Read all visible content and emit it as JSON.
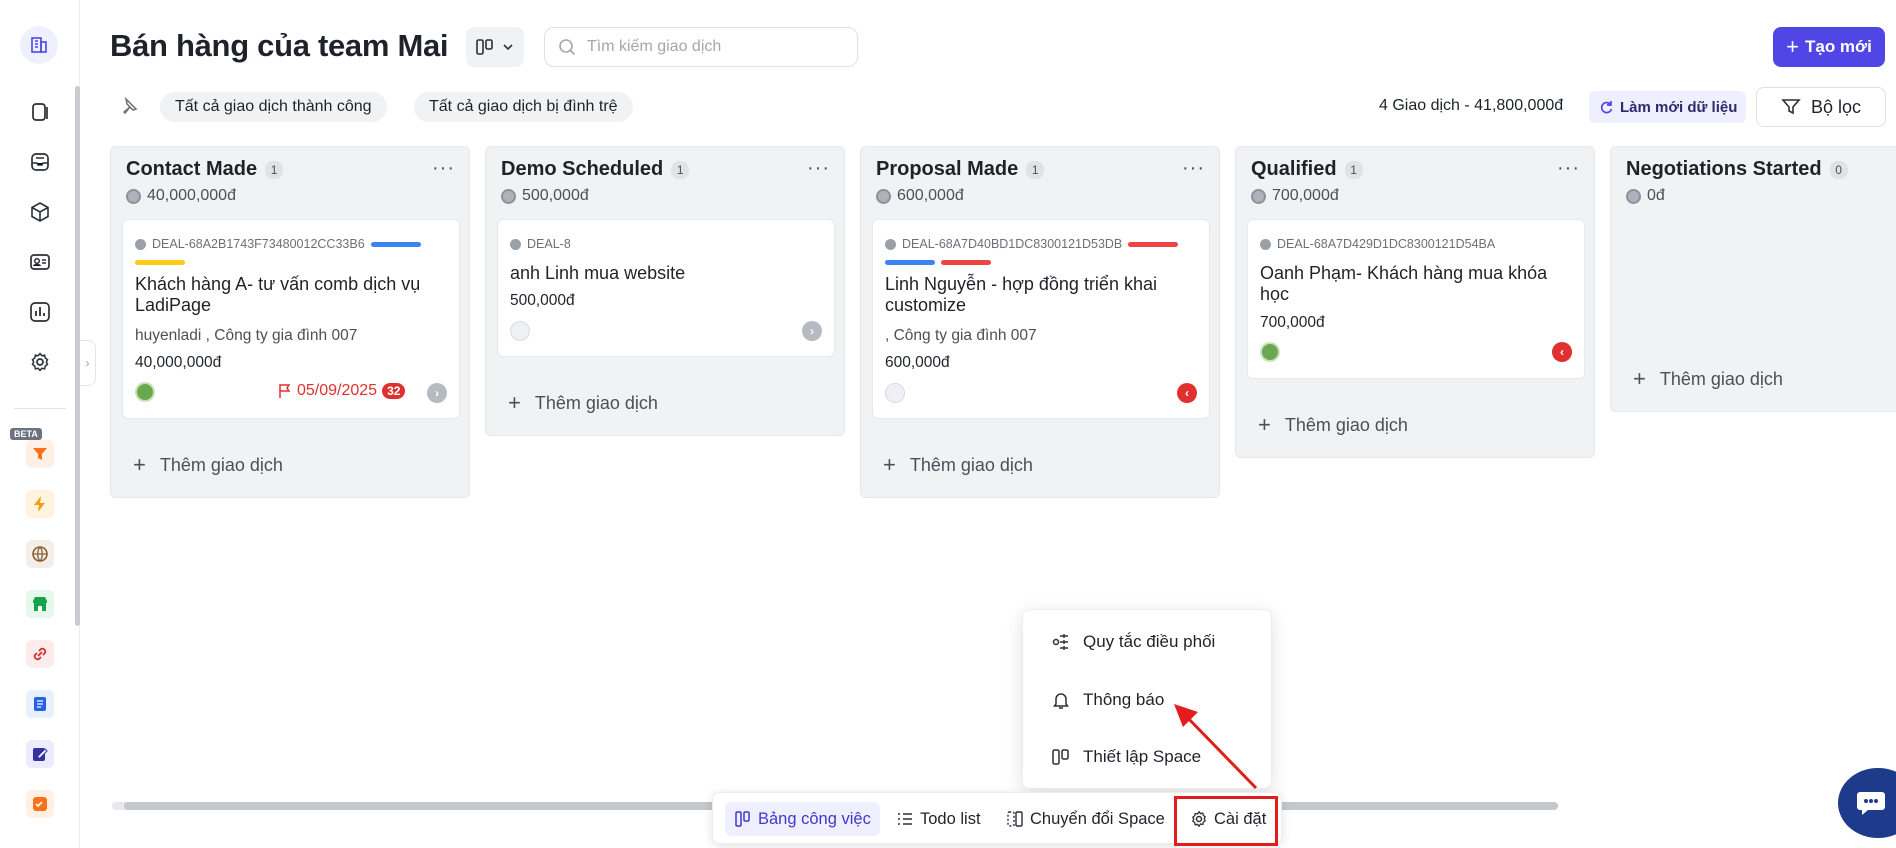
{
  "header": {
    "title": "Bán hàng của team Mai",
    "search_placeholder": "Tìm kiếm giao dịch",
    "new_button": "Tạo mới"
  },
  "sidebar": {
    "beta_badge": "BETA"
  },
  "filters": {
    "chip_success": "Tất cả giao dịch thành công",
    "chip_stuck": "Tất cả giao dịch bị đình trệ",
    "summary": "4 Giao dịch - 41,800,000đ",
    "refresh": "Làm mới dữ liệu",
    "filter_button": "Bộ lọc"
  },
  "columns": [
    {
      "title": "Contact Made",
      "count": "1",
      "total": "40,000,000đ",
      "add_label": "Thêm giao dịch",
      "card": {
        "deal_id": "DEAL-68A2B1743F73480012CC33B6",
        "title": "Khách hàng A- tư vấn comb dịch vụ LadiPage",
        "sub": "huyenladi , Công ty gia đình 007",
        "amount": "40,000,000đ",
        "due": "05/09/2025",
        "badge": "32"
      }
    },
    {
      "title": "Demo Scheduled",
      "count": "1",
      "total": "500,000đ",
      "add_label": "Thêm giao dịch",
      "card": {
        "deal_id": "DEAL-8",
        "title": "anh Linh mua website",
        "amount": "500,000đ"
      }
    },
    {
      "title": "Proposal Made",
      "count": "1",
      "total": "600,000đ",
      "add_label": "Thêm giao dịch",
      "card": {
        "deal_id": "DEAL-68A7D40BD1DC8300121D53DB",
        "title": "Linh Nguyễn - hợp đồng triển khai customize",
        "sub": ", Công ty gia đình 007",
        "amount": "600,000đ"
      }
    },
    {
      "title": "Qualified",
      "count": "1",
      "total": "700,000đ",
      "add_label": "Thêm giao dịch",
      "card": {
        "deal_id": "DEAL-68A7D429D1DC8300121D54BA",
        "title": "Oanh Phạm- Khách hàng mua khóa học",
        "amount": "700,000đ"
      }
    },
    {
      "title": "Negotiations Started",
      "count": "0",
      "total": "0đ",
      "add_label": "Thêm giao dịch"
    }
  ],
  "menu": {
    "items": [
      "Quy tắc điều phối",
      "Thông báo",
      "Thiết lập Space"
    ]
  },
  "toolbar": {
    "board": "Bảng công việc",
    "todo": "Todo list",
    "switch": "Chuyển đổi Space",
    "settings": "Cài đặt"
  },
  "colors": {
    "accent": "#4f46e5",
    "danger": "#e03131",
    "tag_blue": "#3b82f6",
    "tag_yellow": "#facc15",
    "tag_red": "#ef4444"
  }
}
